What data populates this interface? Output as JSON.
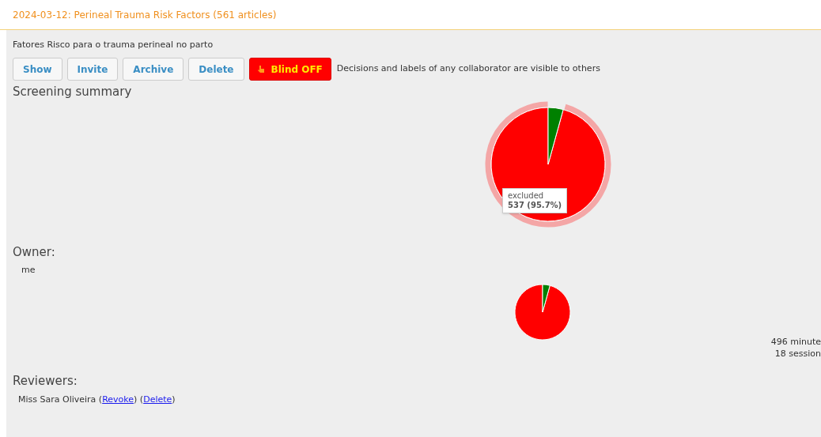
{
  "title": "2024-03-12: Perineal Trauma Risk Factors (561 articles)",
  "description": "Fatores Risco para o trauma perineal no parto",
  "buttons": [
    {
      "label": "Show"
    },
    {
      "label": "Invite"
    },
    {
      "label": "Archive"
    },
    {
      "label": "Delete"
    }
  ],
  "blind_toggle": {
    "label": "Blind OFF",
    "on": false
  },
  "blind_note": "Decisions and labels of any collaborator are visible to others",
  "screening_summary": {
    "heading": "Screening summary",
    "tooltip": {
      "label": "excluded",
      "value": "537 (95.7%)"
    }
  },
  "owner": {
    "heading": "Owner:",
    "name": "me"
  },
  "stats": [
    "496 minute",
    "18 session"
  ],
  "reviewers": {
    "heading": "Reviewers:",
    "items": [
      {
        "name": "Miss Sara Oliveira",
        "links": [
          {
            "open": "(",
            "label": "Revoke",
            "close": ")"
          },
          {
            "open": "(",
            "label": "Delete",
            "close": ")"
          }
        ]
      }
    ]
  }
}
